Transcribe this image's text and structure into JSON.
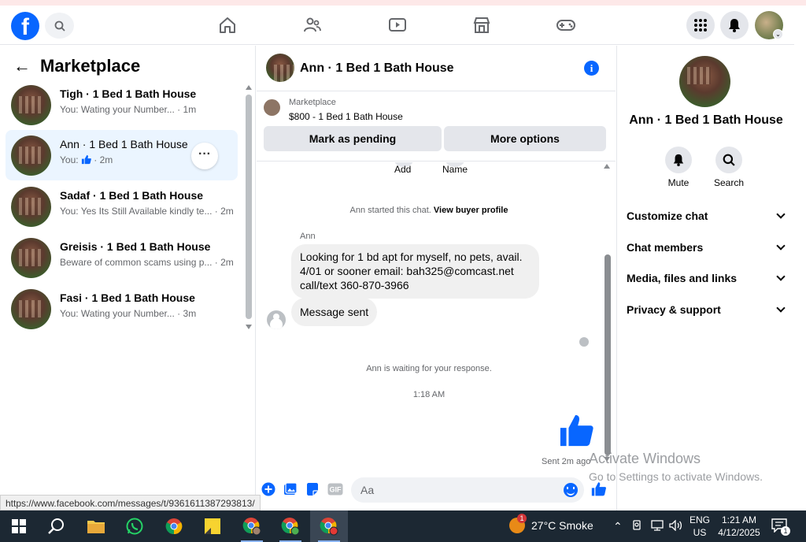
{
  "nav": {
    "logo": "f",
    "icons": [
      "search-icon",
      "home-icon",
      "friends-icon",
      "watch-icon",
      "marketplace-icon",
      "gaming-icon",
      "menu-grid-icon",
      "notifications-icon"
    ]
  },
  "sidebar": {
    "title": "Marketplace",
    "conversations": [
      {
        "name": "Tigh · 1 Bed 1 Bath House",
        "preview": "You: Wating your Number... · 1m"
      },
      {
        "name": "Ann · 1 Bed 1 Bath House",
        "preview_prefix": "You:",
        "preview_suffix": "· 2m"
      },
      {
        "name": "Sadaf · 1 Bed 1 Bath House",
        "preview": "You: Yes Its Still Available kindly te... · 2m"
      },
      {
        "name": "Greisis · 1 Bed 1 Bath House",
        "preview": "Beware of common scams using p... · 2m"
      },
      {
        "name": "Fasi · 1 Bed 1 Bath House",
        "preview": "You: Wating your Number... · 3m"
      }
    ],
    "more_label": "···"
  },
  "chat": {
    "title": "Ann · 1 Bed 1 Bath House",
    "info_label": "i",
    "listing": {
      "source": "Marketplace",
      "title": "$800 - 1 Bed 1 Bath House",
      "mark_pending": "Mark as pending",
      "more_options": "More options"
    },
    "actions_partial": [
      "Add",
      "Name"
    ],
    "started_text": "Ann started this chat.",
    "view_profile": "View buyer profile",
    "sender": "Ann",
    "message_lines": [
      "Looking for 1 bd apt for myself, no pets, avail.",
      "4/01 or sooner email: bah325@comcast.net",
      "call/text 360-870-3966"
    ],
    "message_sent": "Message sent",
    "waiting_text": "Ann is waiting for your response.",
    "time": "1:18 AM",
    "sent_ago": "Sent 2m ago",
    "composer_placeholder": "Aa"
  },
  "details": {
    "name": "Ann · 1 Bed 1 Bath House",
    "mute": "Mute",
    "search": "Search",
    "sections": [
      "Customize chat",
      "Chat members",
      "Media, files and links",
      "Privacy & support"
    ]
  },
  "windows": {
    "activate_title": "Activate Windows",
    "activate_sub": "Go to Settings to activate Windows.",
    "status_url": "https://www.facebook.com/messages/t/9361611387293813/",
    "weather": "27°C  Smoke",
    "weather_badge": "1",
    "lang1": "ENG",
    "lang2": "US",
    "clock_time": "1:21 AM",
    "clock_date": "4/12/2025",
    "notif_count": "1"
  },
  "colors": {
    "accent": "#0866ff",
    "active_row": "#ebf5ff",
    "taskbar": "#1c2833"
  }
}
